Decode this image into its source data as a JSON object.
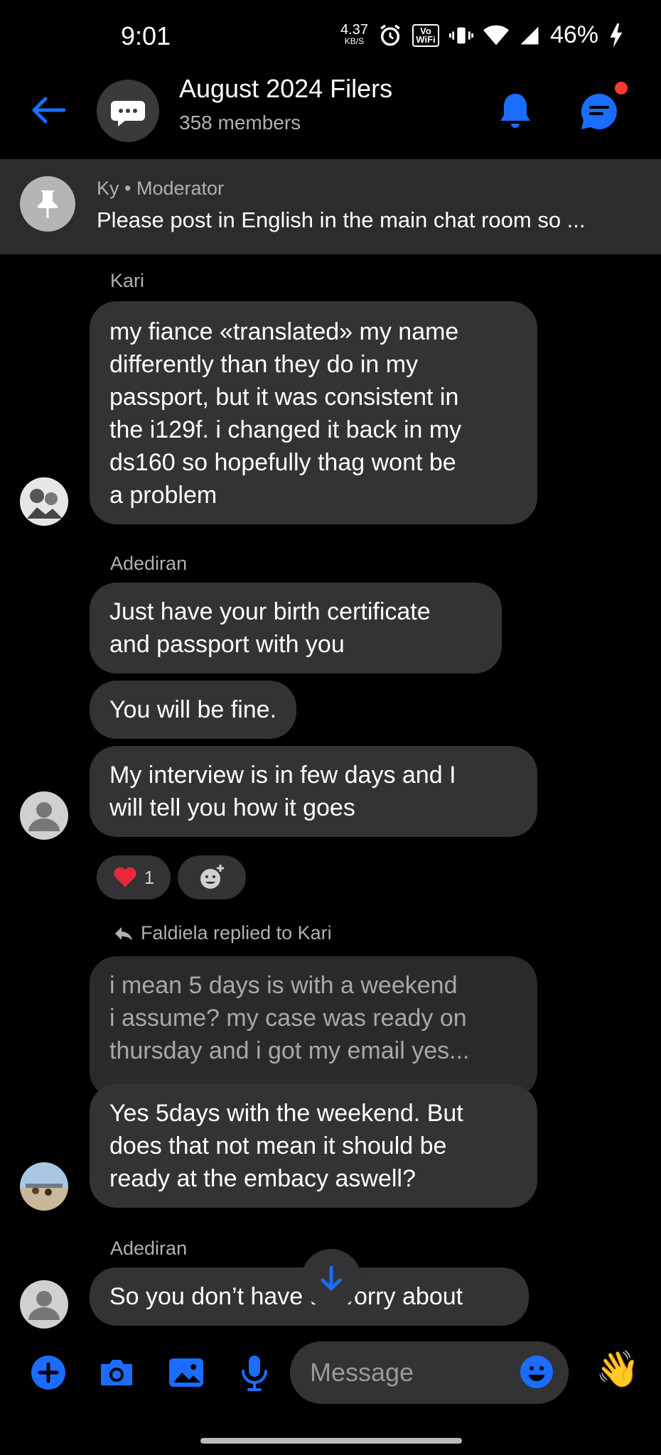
{
  "status_bar": {
    "time": "9:01",
    "net_speed": "4.37",
    "net_unit": "KB/S",
    "vowifi": "Vo WiFi",
    "battery": "46%"
  },
  "header": {
    "title": "August 2024 Filers",
    "members": "358 members"
  },
  "pinned": {
    "author": "Ky",
    "role": "Moderator",
    "separator": " • ",
    "text": "Please post in English in the main chat room so ..."
  },
  "messages": {
    "kari_sender": "Kari",
    "kari_msg": [
      "my fiance «translated» my name",
      "differently than they do in my",
      "passport, but it was consistent in",
      "the i129f. i changed it back in my",
      "ds160 so hopefully thag wont be",
      "a problem"
    ],
    "adediran_sender": "Adediran",
    "adediran_msg1": [
      "Just have your birth certificate",
      "and passport with you"
    ],
    "adediran_msg2": "You will be fine.",
    "adediran_msg3": [
      "My interview is in few days and I",
      "will tell you how it goes"
    ],
    "reaction_count": "1",
    "reply_note": "Faldiela replied to Kari",
    "quoted_msg": [
      "i mean 5 days is with a weekend",
      "i assume? my case was ready on",
      "thursday and i got my email yes..."
    ],
    "faldiela_msg": [
      "Yes 5days with the weekend. But",
      "does that not mean it should be",
      "ready at the embacy aswell?"
    ],
    "adediran_sender2": "Adediran",
    "adediran_msg4": "So you don’t have to worry about"
  },
  "composer": {
    "placeholder": "Message"
  },
  "colors": {
    "accent": "#1a6dff",
    "bubble": "#333335",
    "background": "#000000",
    "notification": "#ff3b30"
  },
  "icons": [
    "back-arrow-icon",
    "chat-bubble-icon",
    "bell-icon",
    "thread-icon",
    "pin-icon",
    "heart-icon",
    "add-reaction-icon",
    "reply-icon",
    "arrow-down-icon",
    "plus-icon",
    "camera-icon",
    "gallery-icon",
    "mic-icon",
    "emoji-icon",
    "wave-icon"
  ]
}
